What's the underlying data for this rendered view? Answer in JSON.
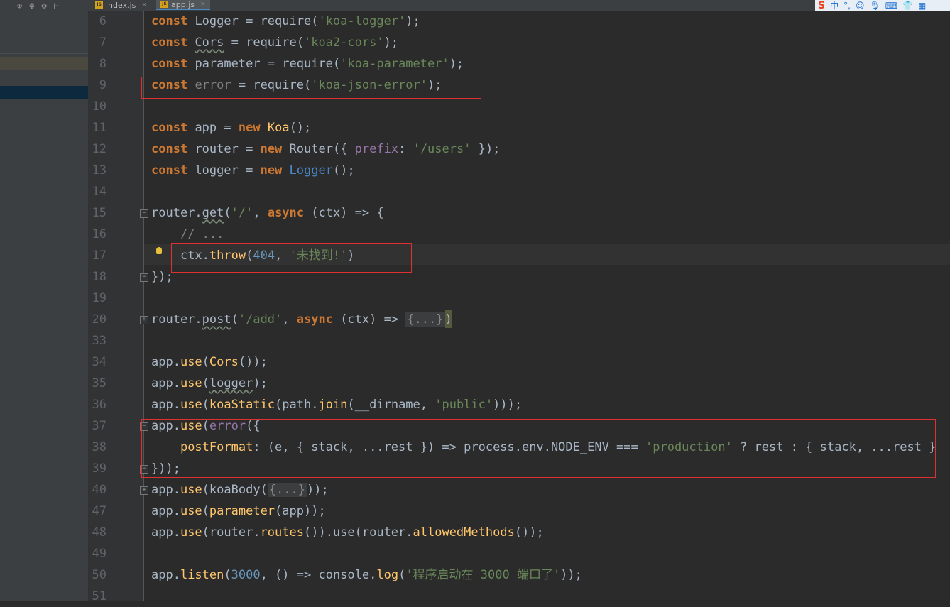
{
  "tabs": [
    {
      "label": "index.js",
      "badge": "JS",
      "close": "×"
    },
    {
      "label": "app.js",
      "badge": "JS",
      "close": "×"
    }
  ],
  "toolbar_icons": [
    "target-icon",
    "collapse-icon",
    "gear-icon",
    "hide-icon"
  ],
  "ime": {
    "logo": "S",
    "lang": "中"
  },
  "line_numbers": [
    "6",
    "7",
    "8",
    "9",
    "10",
    "11",
    "12",
    "13",
    "14",
    "15",
    "16",
    "17",
    "18",
    "19",
    "20",
    "33",
    "34",
    "35",
    "36",
    "37",
    "38",
    "39",
    "40",
    "47",
    "48",
    "49",
    "50",
    "51"
  ],
  "code": {
    "l6": [
      "const",
      "Logger",
      " = require(",
      "'koa-logger'",
      ");"
    ],
    "l7": [
      "const",
      "Cors",
      " = require(",
      "'koa2-cors'",
      ");"
    ],
    "l8": [
      "const",
      "parameter",
      " = require(",
      "'koa-parameter'",
      ");"
    ],
    "l9": [
      "const",
      "error",
      " = require(",
      "'koa-json-error'",
      ");"
    ],
    "l11": [
      "const",
      "app",
      " = ",
      "new",
      "Koa",
      "();"
    ],
    "l12": [
      "const",
      "router",
      " = ",
      "new",
      "Router({ ",
      "prefix",
      ": ",
      "'/users'",
      " });"
    ],
    "l13": [
      "const",
      "logger",
      " = ",
      "new",
      "Logger",
      "();"
    ],
    "l15": [
      "router.",
      "get",
      "(",
      "'/'",
      ", ",
      "async",
      " (ctx) => {"
    ],
    "l16": [
      "// ..."
    ],
    "l17": [
      "ctx.",
      "throw",
      "(",
      "404",
      ", ",
      "'未找到!'",
      ")"
    ],
    "l18": [
      "});"
    ],
    "l20": [
      "router.",
      "post",
      "(",
      "'/add'",
      ", ",
      "async",
      " (ctx) => ",
      "{...}",
      ")"
    ],
    "l34": [
      "app.",
      "use",
      "(",
      "Cors",
      "());"
    ],
    "l35": [
      "app.",
      "use",
      "(",
      "logger",
      ");"
    ],
    "l36": [
      "app.",
      "use",
      "(",
      "koaStatic",
      "(path.",
      "join",
      "(__dirname, ",
      "'public'",
      ")));"
    ],
    "l37": [
      "app.",
      "use",
      "(",
      "error",
      "({"
    ],
    "l38": [
      "postFormat",
      ": (e, { stack, ...rest }) => process.env.NODE_ENV === ",
      "'production'",
      " ? rest : { stack, ...rest }"
    ],
    "l39": [
      "}));"
    ],
    "l40": [
      "app.",
      "use",
      "(koaBody(",
      "{...}",
      "));"
    ],
    "l47": [
      "app.",
      "use",
      "(",
      "parameter",
      "(app));"
    ],
    "l48": [
      "app.",
      "use",
      "(router.",
      "routes",
      "()).use(router.",
      "allowedMethods",
      "());"
    ],
    "l50": [
      "app.",
      "listen",
      "(",
      "3000",
      ", () => console.",
      "log",
      "(",
      "'程序启动在 3000 端口了'",
      "));"
    ]
  }
}
